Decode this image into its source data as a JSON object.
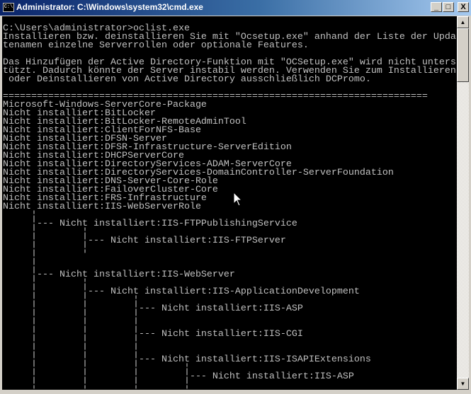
{
  "window": {
    "title": "Administrator: C:\\Windows\\system32\\cmd.exe",
    "icon_label": "C:\\",
    "minimize_glyph": "_",
    "maximize_glyph": "□",
    "close_glyph": "X"
  },
  "scrollbar": {
    "up_glyph": "▲",
    "down_glyph": "▼",
    "position_fraction": 0.0
  },
  "console_lines": [
    "C:\\Users\\administrator>oclist.exe",
    "Installieren bzw. deinstallieren Sie mit \"Ocsetup.exe\" anhand der Liste der Upda",
    "tenamen einzelne Serverrollen oder optionale Features.",
    "",
    "Das Hinzufügen der Active Directory-Funktion mit \"OCSetup.exe\" wird nicht unters",
    "tützt. Dadurch könnte der Server instabil werden. Verwenden Sie zum Installieren",
    " oder Deinstallieren von Active Directory ausschließlich DCPromo.",
    "",
    "===========================================================================",
    "Microsoft-Windows-ServerCore-Package",
    "Nicht installiert:BitLocker",
    "Nicht installiert:BitLocker-RemoteAdminTool",
    "Nicht installiert:ClientForNFS-Base",
    "Nicht installiert:DFSN-Server",
    "Nicht installiert:DFSR-Infrastructure-ServerEdition",
    "Nicht installiert:DHCPServerCore",
    "Nicht installiert:DirectoryServices-ADAM-ServerCore",
    "Nicht installiert:DirectoryServices-DomainController-ServerFoundation",
    "Nicht installiert:DNS-Server-Core-Role",
    "Nicht installiert:FailoverCluster-Core",
    "Nicht installiert:FRS-Infrastructure",
    "Nicht installiert:IIS-WebServerRole",
    "     ¦",
    "     ¦--- Nicht installiert:IIS-FTPPublishingService",
    "     ¦        ¦",
    "     ¦        ¦--- Nicht installiert:IIS-FTPServer",
    "     ¦        ¦",
    "     ¦",
    "     ¦",
    "     ¦--- Nicht installiert:IIS-WebServer",
    "     ¦        ¦",
    "     ¦        ¦--- Nicht installiert:IIS-ApplicationDevelopment",
    "     ¦        ¦        ¦",
    "     ¦        ¦        ¦--- Nicht installiert:IIS-ASP",
    "     ¦        ¦        ¦",
    "     ¦        ¦        ¦",
    "     ¦        ¦        ¦--- Nicht installiert:IIS-CGI",
    "     ¦        ¦        ¦",
    "     ¦        ¦        ¦",
    "     ¦        ¦        ¦--- Nicht installiert:IIS-ISAPIExtensions",
    "     ¦        ¦        ¦        ¦",
    "     ¦        ¦        ¦        ¦--- Nicht installiert:IIS-ASP",
    "     ¦        ¦        ¦        ¦"
  ]
}
